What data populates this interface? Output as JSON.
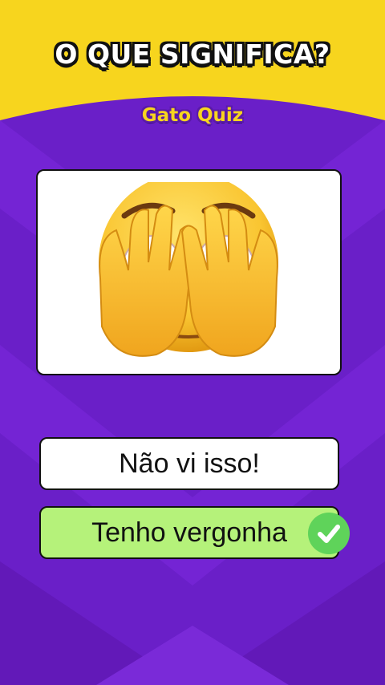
{
  "header": {
    "title": "O QUE SIGNIFICA?",
    "brand": "Gato Quiz"
  },
  "question": {
    "emoji_icon": "face-with-hands-over-eyes-icon"
  },
  "options": [
    {
      "label": "Não vi isso!",
      "state": "default"
    },
    {
      "label": "Tenho vergonha",
      "state": "correct"
    }
  ],
  "colors": {
    "header_yellow": "#f7d51e",
    "background_purple": "#6a1fc8",
    "correct_green": "#b5f27a",
    "check_green": "#5fd35a"
  }
}
